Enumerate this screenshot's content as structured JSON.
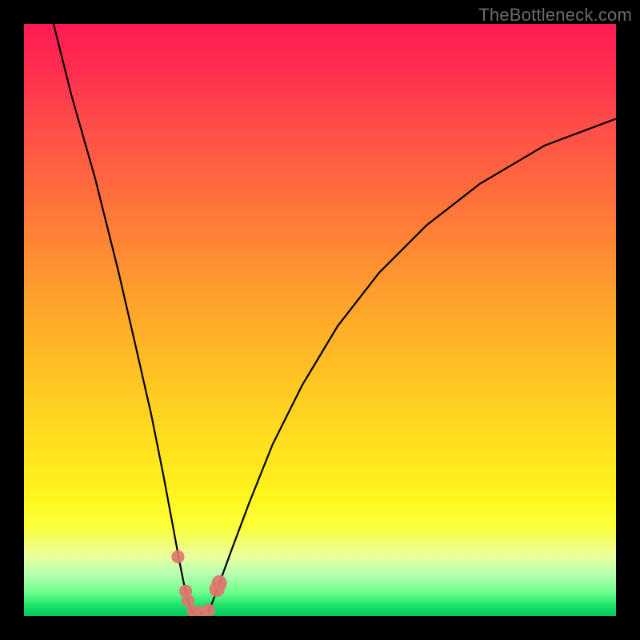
{
  "watermark": "TheBottleneck.com",
  "colors": {
    "frame": "#000000",
    "curve": "#000000",
    "marker": "#e0756f",
    "gradient_top": "#ff1a53",
    "gradient_bottom": "#00c95c"
  },
  "chart_data": {
    "type": "line",
    "title": "",
    "xlabel": "",
    "ylabel": "",
    "xlim": [
      0,
      100
    ],
    "ylim": [
      0,
      100
    ],
    "annotations": [
      "TheBottleneck.com"
    ],
    "series": [
      {
        "name": "left-branch",
        "x": [
          5,
          8,
          12,
          16,
          19,
          21.5,
          23.5,
          25,
          26.2,
          27,
          27.6,
          28.1,
          28.5
        ],
        "y": [
          100,
          88,
          74,
          58,
          45,
          34,
          24,
          16,
          9.5,
          5.5,
          3,
          1.3,
          0.5
        ]
      },
      {
        "name": "right-branch",
        "x": [
          31,
          31.7,
          33,
          35,
          38,
          42,
          47,
          53,
          60,
          68,
          77,
          88,
          100
        ],
        "y": [
          0.5,
          2,
          5.5,
          11,
          19,
          29,
          39,
          49,
          58,
          66,
          73,
          79.5,
          84
        ]
      }
    ],
    "floor": {
      "name": "valley-floor",
      "x": [
        28.5,
        31
      ],
      "y": [
        0.5,
        0.5
      ]
    },
    "markers": [
      {
        "name": "pt-left-upper",
        "x": 26.0,
        "y": 10.0,
        "r": 1.1
      },
      {
        "name": "pt-left-a",
        "x": 27.3,
        "y": 4.2,
        "r": 1.1
      },
      {
        "name": "pt-left-b",
        "x": 27.7,
        "y": 2.6,
        "r": 1.1
      },
      {
        "name": "pt-floor-a",
        "x": 28.6,
        "y": 0.8,
        "r": 1.1
      },
      {
        "name": "pt-floor-b",
        "x": 30.0,
        "y": 0.6,
        "r": 1.1
      },
      {
        "name": "pt-floor-c",
        "x": 31.2,
        "y": 1.0,
        "r": 1.1
      },
      {
        "name": "pt-right-a",
        "x": 32.6,
        "y": 4.5,
        "r": 1.3
      },
      {
        "name": "pt-right-b",
        "x": 33.0,
        "y": 5.6,
        "r": 1.3
      }
    ]
  }
}
